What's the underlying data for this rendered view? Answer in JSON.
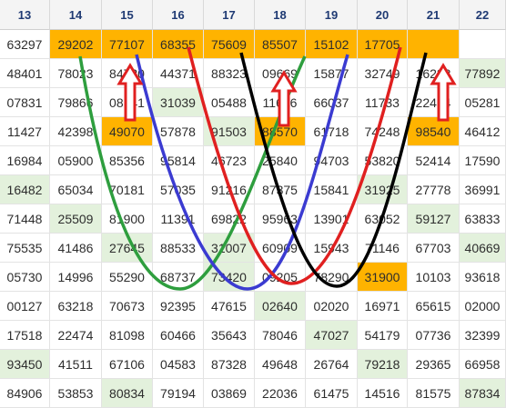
{
  "columns": [
    "13",
    "14",
    "15",
    "16",
    "17",
    "18",
    "19",
    "20",
    "21",
    "22"
  ],
  "rows": [
    [
      "63297",
      "29202",
      "77107",
      "68355",
      "75609",
      "85507",
      "15102",
      "17705",
      "",
      ""
    ],
    [
      "48401",
      "78023",
      "84720",
      "44371",
      "88323",
      "09669",
      "15877",
      "32749",
      "16238",
      "77892"
    ],
    [
      "07831",
      "79866",
      "08141",
      "31039",
      "05488",
      "11656",
      "66037",
      "11733",
      "22464",
      "05281"
    ],
    [
      "11427",
      "42398",
      "49070",
      "57878",
      "91503",
      "88570",
      "61718",
      "74248",
      "98540",
      "46412"
    ],
    [
      "16984",
      "05900",
      "85356",
      "95814",
      "46723",
      "25840",
      "94703",
      "53820",
      "52414",
      "17590"
    ],
    [
      "16482",
      "65034",
      "70181",
      "57035",
      "91216",
      "87375",
      "15841",
      "31925",
      "27778",
      "36991"
    ],
    [
      "71448",
      "25509",
      "81900",
      "11391",
      "69822",
      "95963",
      "13901",
      "63052",
      "59127",
      "63833"
    ],
    [
      "75535",
      "41486",
      "27645",
      "88533",
      "31007",
      "60909",
      "15943",
      "71146",
      "67703",
      "40669"
    ],
    [
      "05730",
      "14996",
      "55290",
      "68737",
      "73420",
      "09205",
      "78290",
      "31900",
      "10103",
      "93618"
    ],
    [
      "00127",
      "63218",
      "70673",
      "92395",
      "47615",
      "02640",
      "02020",
      "16971",
      "65615",
      "02000"
    ],
    [
      "17518",
      "22474",
      "81098",
      "60466",
      "35643",
      "78046",
      "47027",
      "54179",
      "07736",
      "32399"
    ],
    [
      "93450",
      "41511",
      "67106",
      "04583",
      "87328",
      "49648",
      "26764",
      "79218",
      "29365",
      "66958"
    ],
    [
      "84906",
      "53853",
      "80834",
      "79194",
      "03869",
      "22036",
      "61475",
      "14516",
      "81575",
      "87834"
    ]
  ],
  "highlights": {
    "orange": [
      "0-1",
      "0-2",
      "0-3",
      "0-4",
      "0-5",
      "0-6",
      "0-7",
      "0-8",
      "3-2",
      "3-5",
      "3-8",
      "8-7"
    ],
    "green": [
      "1-9",
      "2-3",
      "3-4",
      "5-0",
      "5-7",
      "6-1",
      "6-8",
      "7-2",
      "7-4",
      "7-9",
      "8-4",
      "9-5",
      "10-6",
      "11-0",
      "11-7",
      "12-2",
      "12-9"
    ],
    "white": [
      "0-9"
    ]
  },
  "annotations": {
    "curves": [
      {
        "color": "#2e9e3e",
        "name": "green-curve"
      },
      {
        "color": "#3b3bd1",
        "name": "blue-curve"
      },
      {
        "color": "#e02020",
        "name": "red-curve"
      },
      {
        "color": "#000000",
        "name": "black-curve"
      }
    ],
    "arrow_color": "#e02020",
    "arrow_count": 3
  }
}
